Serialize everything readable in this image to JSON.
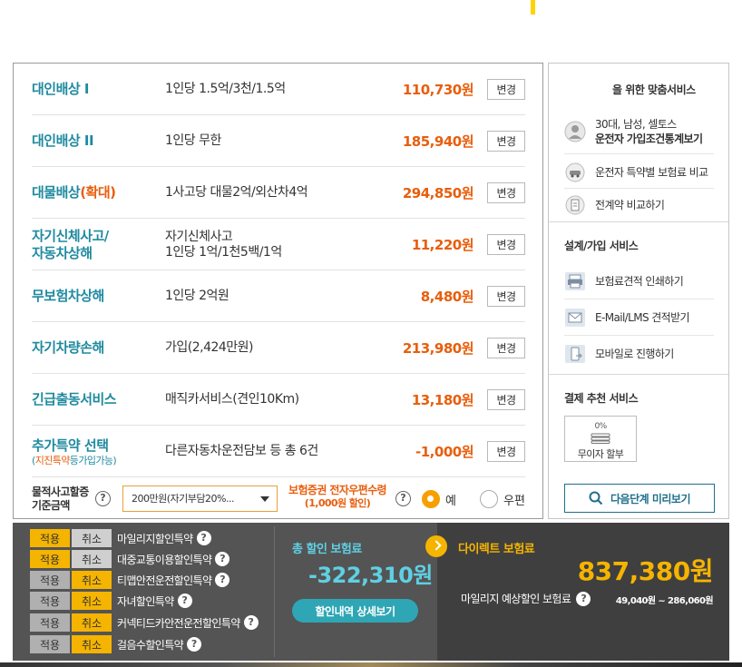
{
  "coverages": [
    {
      "name": "대인배상 I",
      "desc": [
        "1인당 1.5억/3천/1.5억"
      ],
      "price": "110,730원",
      "btn": "변경"
    },
    {
      "name": "대인배상 II",
      "desc": [
        "1인당 무한"
      ],
      "price": "185,940원",
      "btn": "변경"
    },
    {
      "name": "대물배상",
      "name_extra": "(확대)",
      "desc": [
        "1사고당 대물2억/외산차4억"
      ],
      "price": "294,850원",
      "btn": "변경"
    },
    {
      "name": "자기신체사고/",
      "name2": "자동차상해",
      "desc": [
        "자기신체사고",
        "1인당 1억/1천5백/1억"
      ],
      "price": "11,220원",
      "btn": "변경"
    },
    {
      "name": "무보험차상해",
      "desc": [
        "1인당 2억원"
      ],
      "price": "8,480원",
      "btn": "변경"
    },
    {
      "name": "자기차량손해",
      "desc": [
        "가입(2,424만원)"
      ],
      "price": "213,980원",
      "btn": "변경"
    },
    {
      "name": "긴급출동서비스",
      "desc": [
        "매직카서비스(견인10Km)"
      ],
      "price": "13,180원",
      "btn": "변경"
    },
    {
      "name": "추가특약 선택",
      "sub_red": "지진특약",
      "sub_rest": "등가입가능",
      "desc": [
        "다른자동차운전담보 등 총 6건"
      ],
      "price": "-1,000원",
      "btn": "변경"
    }
  ],
  "deductible": {
    "label1": "물적사고할증",
    "label2": "기준금액",
    "select_value": "200만원(자기부담20%...",
    "post_label": "보험증권 전자우편수령",
    "post_sub": "(1,000원 할인)",
    "opt_yes": "예",
    "opt_mail": "우편"
  },
  "side": {
    "title": "을 위한 맞춤서비스",
    "profile1": "30대, 남성, 셀토스",
    "profile2": "운전자 가입조건통계보기",
    "compare_rider": "운전자 특약별 보험료 비교",
    "compare_prev": "전계약 비교하기",
    "design_title": "설계/가입 서비스",
    "print_quote": "보험료견적 인쇄하기",
    "email_quote": "E-Mail/LMS 견적받기",
    "mobile": "모바일로 진행하기",
    "pay_title": "결제 추천 서비스",
    "pct": "0%",
    "no_interest": "무이자 할부",
    "preview": "다음단계 미리보기"
  },
  "discounts": [
    {
      "apply": "적용",
      "cancel": "취소",
      "name": "마일리지할인특약",
      "state": "applied"
    },
    {
      "apply": "적용",
      "cancel": "취소",
      "name": "대중교통이용할인특약",
      "state": "applied"
    },
    {
      "apply": "적용",
      "cancel": "취소",
      "name": "티맵안전운전할인특약",
      "state": "cancelled"
    },
    {
      "apply": "적용",
      "cancel": "취소",
      "name": "자녀할인특약",
      "state": "cancelled"
    },
    {
      "apply": "적용",
      "cancel": "취소",
      "name": "커넥티드카안전운전할인특약",
      "state": "cancelled"
    },
    {
      "apply": "적용",
      "cancel": "취소",
      "name": "걸음수할인특약",
      "state": "cancelled"
    }
  ],
  "summary": {
    "total_label": "총 할인 보험료",
    "total_value": "-322,310원",
    "detail_btn": "할인내역 상세보기",
    "direct_label": "다이렉트 보험료",
    "direct_value": "837,380원",
    "mileage_label": "마일리지 예상할인 보험료",
    "mileage_range": "49,040원 ~ 286,060원"
  },
  "colors": {
    "accent_orange": "#e85e0c",
    "accent_teal": "#1f8aa0",
    "accent_yellow": "#f5b400"
  },
  "help_mark": "?"
}
